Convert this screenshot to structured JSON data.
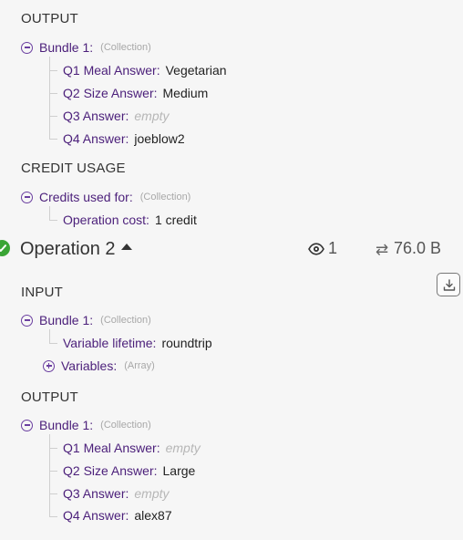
{
  "output1": {
    "title": "OUTPUT",
    "bundle_label": "Bundle 1:",
    "bundle_type": "(Collection)",
    "items": [
      {
        "key": "Q1 Meal Answer:",
        "value": "Vegetarian"
      },
      {
        "key": "Q2 Size Answer:",
        "value": "Medium"
      },
      {
        "key": "Q3 Answer:",
        "value": "empty"
      },
      {
        "key": "Q4 Answer:",
        "value": "joeblow2"
      }
    ]
  },
  "credit_usage": {
    "title": "CREDIT USAGE",
    "label": "Credits used for:",
    "type": "(Collection)",
    "item": {
      "key": "Operation cost:",
      "value": "1 credit"
    }
  },
  "operation2": {
    "title": "Operation 2",
    "view_count": "1",
    "data_size": "76.0 B",
    "status_color": "#3aa535"
  },
  "input": {
    "title": "INPUT",
    "bundle_label": "Bundle 1:",
    "bundle_type": "(Collection)",
    "lifetime": {
      "key": "Variable lifetime:",
      "value": "roundtrip"
    },
    "variables": {
      "key": "Variables:",
      "type": "(Array)"
    }
  },
  "output2": {
    "title": "OUTPUT",
    "bundle_label": "Bundle 1:",
    "bundle_type": "(Collection)",
    "items": [
      {
        "key": "Q1 Meal Answer:",
        "value": "empty"
      },
      {
        "key": "Q2 Size Answer:",
        "value": "Large"
      },
      {
        "key": "Q3 Answer:",
        "value": "empty"
      },
      {
        "key": "Q4 Answer:",
        "value": "alex87"
      }
    ]
  }
}
